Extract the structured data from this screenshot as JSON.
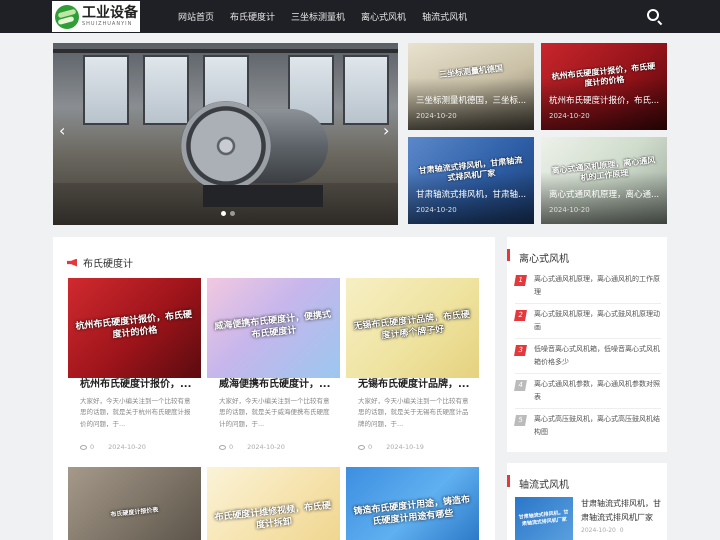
{
  "header": {
    "logo": {
      "cn": "工业设备",
      "en": "SHUIZHUANYIN"
    },
    "nav": [
      "网站首页",
      "布氏硬度计",
      "三坐标测量机",
      "离心式风机",
      "轴流式风机"
    ]
  },
  "slider": {
    "prev": "‹",
    "next": "›"
  },
  "featured": [
    {
      "overlay": "三坐标测量机德国",
      "title": "三坐标测量机德国，三坐标...",
      "date": "2024-10-20"
    },
    {
      "overlay": "杭州布氏硬度计报价，布氏硬度计的价格",
      "title": "杭州布氏硬度计报价，布氏...",
      "date": "2024-10-20"
    },
    {
      "overlay": "甘肃轴流式排风机，甘肃轴流式排风机厂家",
      "title": "甘肃轴流式排风机，甘肃轴...",
      "date": "2024-10-20"
    },
    {
      "overlay": "离心式通风机原理，离心通风机的工作原理",
      "title": "离心式通风机原理，离心通...",
      "date": "2024-10-20"
    }
  ],
  "main": {
    "section_title": "布氏硬度计",
    "posts": [
      {
        "thumb_text": "杭州布氏硬度计报价，布氏硬度计的价格",
        "title": "杭州布氏硬度计报价，...",
        "desc": "大家好，今天小编关注到一个比较有意思的话题，就是关于杭州布氏硬度计报价的问题，于...",
        "views": "0",
        "date": "2024-10-20"
      },
      {
        "thumb_text": "威海便携布氏硬度计，便携式布氏硬度计",
        "title": "威海便携布氏硬度计，...",
        "desc": "大家好，今天小编关注到一个比较有意思的话题，就是关于威海便携布氏硬度计的问题，于...",
        "views": "0",
        "date": "2024-10-20"
      },
      {
        "thumb_text": "无锡布氏硬度计品牌，布氏硬度计哪个牌子好",
        "title": "无锡布氏硬度计品牌，...",
        "desc": "大家好，今天小编关注到一个比较有意思的话题，就是关于无锡布氏硬度计品牌的问题，于...",
        "views": "0",
        "date": "2024-10-19"
      },
      {
        "thumb_text": "布氏硬度计报价表",
        "title": "",
        "desc": "",
        "views": "",
        "date": ""
      },
      {
        "thumb_text": "布氏硬度计维修视频，布氏硬度计拆卸",
        "title": "",
        "desc": "",
        "views": "",
        "date": ""
      },
      {
        "thumb_text": "铸造布氏硬度计用途，铸造布氏硬度计用途有哪些",
        "title": "",
        "desc": "",
        "views": "",
        "date": ""
      }
    ]
  },
  "sidebar": {
    "centrifugal": {
      "title": "离心式风机",
      "items": [
        {
          "num": "1",
          "text": "离心式通风机原理，离心通风机的工作原理"
        },
        {
          "num": "2",
          "text": "离心式鼓风机原理，离心式鼓风机原理动画"
        },
        {
          "num": "3",
          "text": "低噪音离心式风机箱，低噪音离心式风机箱价格多少"
        },
        {
          "num": "4",
          "text": "离心式通风机参数，离心通风机参数对照表"
        },
        {
          "num": "5",
          "text": "离心式高压鼓风机，离心式高压鼓风机结构图"
        }
      ]
    },
    "axial": {
      "title": "轴流式风机",
      "item": {
        "thumb": "甘肃轴流式排风机，甘肃轴流式排风机厂家",
        "text": "甘肃轴流式排风机，甘肃轴流式排风机厂家",
        "date": "2024-10-20",
        "views": "0"
      }
    }
  },
  "colors": {
    "accent": "#e4393c",
    "topbar": "#1f2025",
    "rank_gray": "#bbbbbb"
  }
}
